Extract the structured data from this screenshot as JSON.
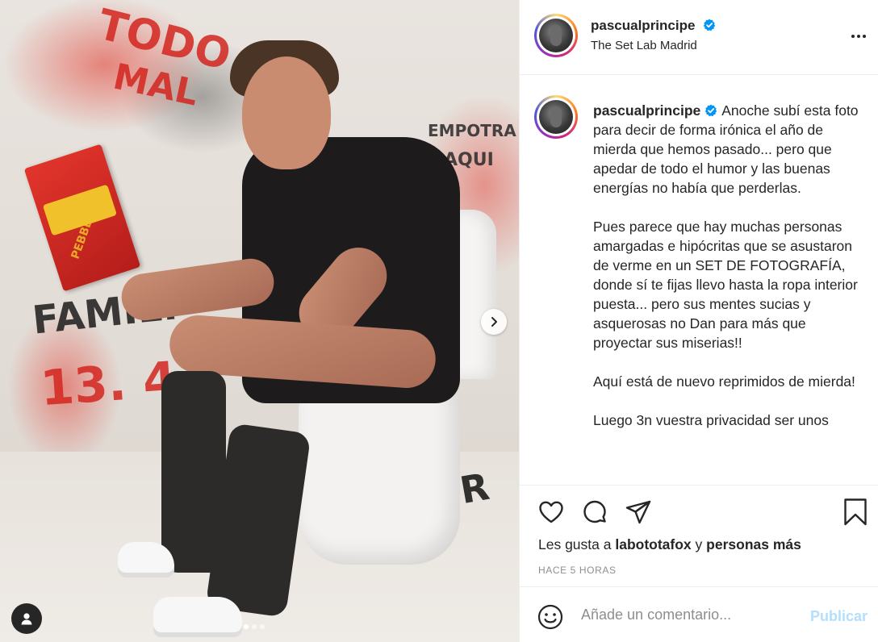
{
  "post": {
    "username": "pascualprincipe",
    "location": "The Set Lab Madrid",
    "verified": true,
    "caption": "Anoche subí esta foto para decir de forma irónica el año de mierda que hemos pasado... pero que apedar de todo el humor y las buenas energías no había que perderlas.\n\nPues parece que hay muchas personas amargadas e hipócritas que se asustaron de verme en un SET DE FOTOGRAFÍA, donde sí te fijas llevo hasta la ropa interior puesta... pero sus mentes sucias y asquerosas no Dan para más que proyectar sus miserias!!\n\nAquí está de nuevo reprimidos de mierda!\n\nLuego 3n vuestra privacidad ser unos",
    "likes": {
      "prefix": "Les gusta a",
      "first_user": "labototafox",
      "joiner": "y",
      "rest": "personas más"
    },
    "timestamp": "HACE 5 HORAS"
  },
  "media": {
    "carousel_dots": 3,
    "active_dot": 0,
    "graffiti": [
      "TODO",
      "MAL",
      "FAMILY",
      "13. 41",
      "EMPOTRA",
      "AQUI",
      "LOSER",
      "PEBBLES"
    ]
  },
  "comment": {
    "placeholder": "Añade un comentario...",
    "publish_label": "Publicar"
  },
  "colors": {
    "verified_blue": "#0095f6",
    "publish_disabled": "#b2dffc",
    "muted_text": "#8e8e8e"
  },
  "icons": {
    "like": "heart-icon",
    "comment": "comment-icon",
    "share": "paper-plane-icon",
    "save": "bookmark-icon",
    "more": "more-horizontal-icon",
    "emoji": "smiley-icon",
    "next": "chevron-right-icon",
    "tags": "user-tag-icon"
  }
}
